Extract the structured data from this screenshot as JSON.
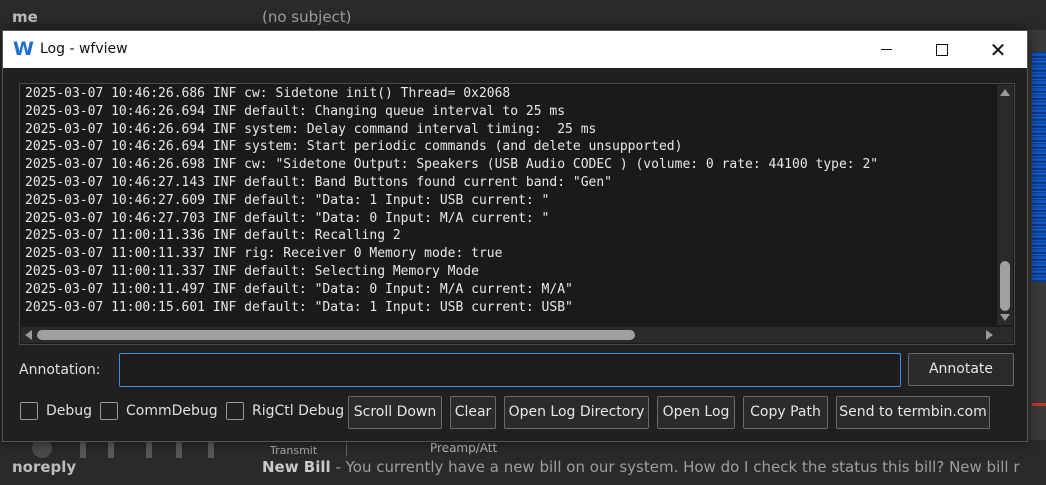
{
  "background": {
    "top_row": {
      "sender": "me",
      "subject": "(no subject)"
    },
    "bottom_row": {
      "sender": "noreply",
      "subject_bold": "New Bill",
      "subject_rest": " - You currently have a new bill on our system. How do I check the status this bill? New bill r"
    },
    "transmit_label": "Transmit",
    "preamp_label": "Preamp/Att"
  },
  "window": {
    "logo": "W",
    "title": "Log - wfview"
  },
  "log": {
    "lines": [
      "2025-03-07 10:46:26.686 INF cw: Sidetone init() Thread= 0x2068",
      "2025-03-07 10:46:26.694 INF default: Changing queue interval to 25 ms",
      "2025-03-07 10:46:26.694 INF system: Delay command interval timing:  25 ms",
      "2025-03-07 10:46:26.694 INF system: Start periodic commands (and delete unsupported)",
      "2025-03-07 10:46:26.698 INF cw: \"Sidetone Output: Speakers (USB Audio CODEC ) (volume: 0 rate: 44100 type: 2\"",
      "2025-03-07 10:46:27.143 INF default: Band Buttons found current band: \"Gen\"",
      "2025-03-07 10:46:27.609 INF default: \"Data: 1 Input: USB current: \"",
      "2025-03-07 10:46:27.703 INF default: \"Data: 0 Input: M/A current: \"",
      "2025-03-07 11:00:11.336 INF default: Recalling 2",
      "2025-03-07 11:00:11.337 INF rig: Receiver 0 Memory mode: true",
      "2025-03-07 11:00:11.337 INF default: Selecting Memory Mode",
      "2025-03-07 11:00:11.497 INF default: \"Data: 0 Input: M/A current: M/A\"",
      "2025-03-07 11:00:15.601 INF default: \"Data: 1 Input: USB current: USB\""
    ]
  },
  "annotation": {
    "label": "Annotation:",
    "value": "",
    "button": "Annotate"
  },
  "controls": {
    "debug": {
      "label": "Debug",
      "checked": false
    },
    "commdebug": {
      "label": "CommDebug",
      "checked": false
    },
    "rigctl_debug": {
      "label": "RigCtl Debug",
      "checked": false
    },
    "scroll_down": "Scroll Down",
    "clear": "Clear",
    "open_log_directory": "Open Log Directory",
    "open_log": "Open Log",
    "copy_path": "Copy Path",
    "send_termbin": "Send to termbin.com"
  },
  "colors": {
    "accent": "#3d8fe0",
    "logo": "#1f6fd1",
    "window_bg": "#202020",
    "log_bg": "#1a1a1a"
  },
  "icons": {
    "minimize": "minimize-icon",
    "maximize": "maximize-icon",
    "close": "close-icon"
  }
}
